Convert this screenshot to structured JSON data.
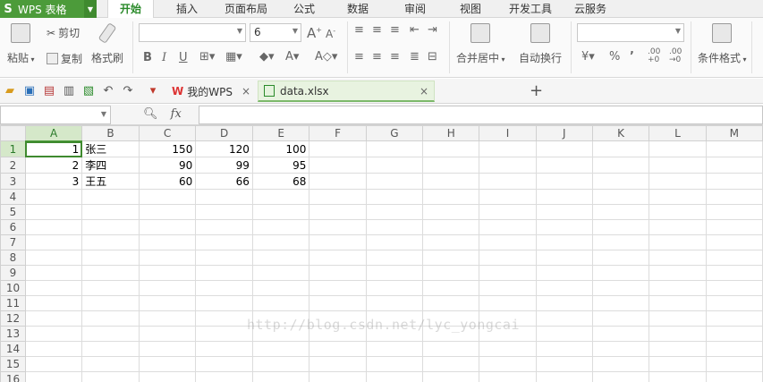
{
  "app": {
    "logo": "S",
    "name": "WPS 表格"
  },
  "menu_tabs": [
    "开始",
    "插入",
    "页面布局",
    "公式",
    "数据",
    "审阅",
    "视图",
    "开发工具",
    "云服务"
  ],
  "active_menu": "开始",
  "ribbon": {
    "paste": "粘贴",
    "cut": "剪切",
    "copy": "复制",
    "format_painter": "格式刷",
    "font_name": "",
    "font_size": "6",
    "merge_center": "合并居中",
    "wrap_text": "自动换行",
    "number_format": "",
    "percent": "%",
    "comma": "’",
    "inc_decimal": ".00",
    "dec_decimal": ".00",
    "conditional_format": "条件格式",
    "bold": "B",
    "italic": "I",
    "underline": "U",
    "font_grow": "A",
    "font_shrink": "A"
  },
  "doc_tabs": [
    {
      "label": "我的WPS",
      "close": "×"
    },
    {
      "label": "data.xlsx",
      "close": "×"
    }
  ],
  "new_tab": "+",
  "formula_bar": {
    "name_box": "",
    "fx_label": "fx",
    "formula": ""
  },
  "columns": [
    "A",
    "B",
    "C",
    "D",
    "E",
    "F",
    "G",
    "H",
    "I",
    "J",
    "K",
    "L",
    "M"
  ],
  "rows": [
    "1",
    "2",
    "3",
    "4",
    "5",
    "6",
    "7",
    "8",
    "9",
    "10",
    "11",
    "12",
    "13",
    "14",
    "15",
    "16"
  ],
  "cells": [
    [
      "1",
      "张三",
      "150",
      "120",
      "100"
    ],
    [
      "2",
      "李四",
      "90",
      "99",
      "95"
    ],
    [
      "3",
      "王五",
      "60",
      "66",
      "68"
    ]
  ],
  "active_cell": "A1",
  "watermark": "http://blog.csdn.net/lyc_yongcai",
  "colors": {
    "accent": "#4c9b3a",
    "selected_header": "#d5e8c9"
  }
}
